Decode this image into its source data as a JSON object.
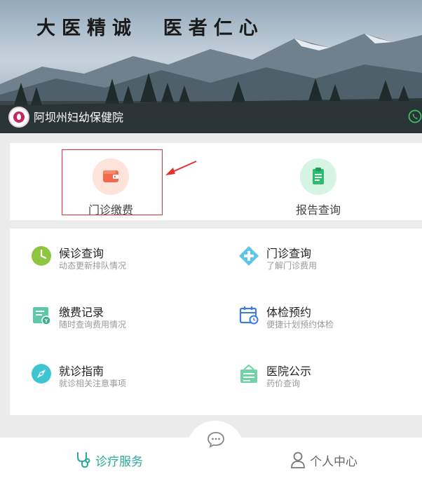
{
  "banner": {
    "slogan": "大医精诚  医者仁心",
    "hospital_name": "阿坝州妇幼保健院"
  },
  "quick_actions": [
    {
      "label": "门诊缴费",
      "icon": "wallet-icon",
      "color": "#f26a4b"
    },
    {
      "label": "报告查询",
      "icon": "clipboard-icon",
      "color": "#2dbb6e"
    }
  ],
  "services": [
    {
      "title": "候诊查询",
      "subtitle": "动态更新排队情况",
      "icon": "clock-icon",
      "color": "#8fc640"
    },
    {
      "title": "门诊查询",
      "subtitle": "了解门诊费用",
      "icon": "medical-cross-icon",
      "color": "#5dc6e8"
    },
    {
      "title": "缴费记录",
      "subtitle": "随时查询费用情况",
      "icon": "payment-record-icon",
      "color": "#5dc9a8"
    },
    {
      "title": "体检预约",
      "subtitle": "便捷计划预约体检",
      "icon": "calendar-icon",
      "color": "#3d7dd8"
    },
    {
      "title": "就诊指南",
      "subtitle": "就诊相关注意事项",
      "icon": "compass-icon",
      "color": "#3dc6d2"
    },
    {
      "title": "医院公示",
      "subtitle": "药价查询",
      "icon": "notice-board-icon",
      "color": "#6fd3a6"
    }
  ],
  "tabbar": {
    "service_label": "诊疗服务",
    "user_label": "个人中心",
    "active_color": "#2aa99a"
  }
}
